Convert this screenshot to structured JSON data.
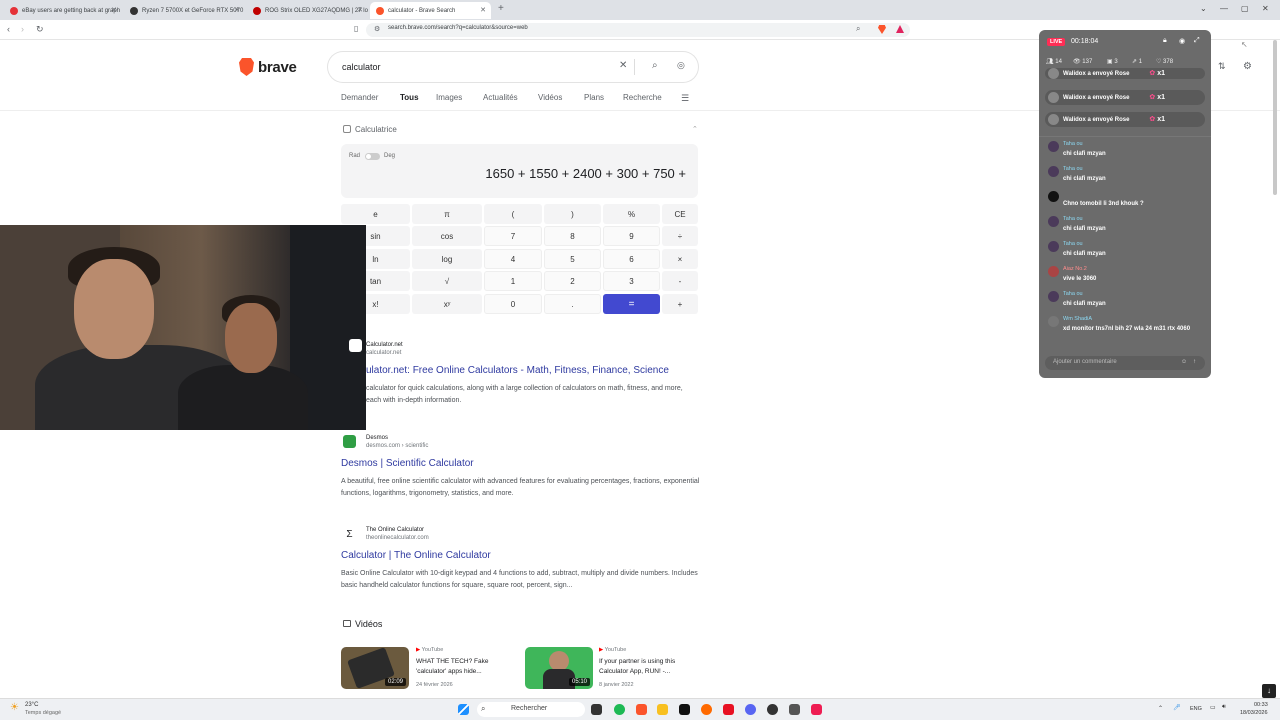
{
  "tabs": [
    {
      "title": "eBay users are getting back at graph",
      "color": "#e53238"
    },
    {
      "title": "Ryzen 7 5700X et GeForce RTX 5070",
      "color": "#333333"
    },
    {
      "title": "ROG Strix OLED XG27AQDMG | 27 lo",
      "color": "#c00000"
    },
    {
      "title": "calculator - Brave Search",
      "color": "#fb542b"
    }
  ],
  "new_tab": "+",
  "url": "search.brave.com/search?q=calculator&source=web",
  "brand": "brave",
  "search_query": "calculator",
  "nav_tabs": [
    "Demander",
    "Tous",
    "Images",
    "Actualités",
    "Vidéos",
    "Plans",
    "Recherche"
  ],
  "calc": {
    "title": "Calculatrice",
    "rad": "Rad",
    "deg": "Deg",
    "expression": "1650 + 1550 + 2400 + 300 + 750 +",
    "keys": [
      [
        "e",
        "π",
        "(",
        ")",
        "%",
        "CE"
      ],
      [
        "sin",
        "cos",
        "7",
        "8",
        "9",
        "÷"
      ],
      [
        "ln",
        "log",
        "4",
        "5",
        "6",
        "×"
      ],
      [
        "tan",
        "√",
        "1",
        "2",
        "3",
        "-"
      ],
      [
        "x!",
        "xʸ",
        "0",
        ".",
        "=",
        "+"
      ]
    ]
  },
  "results": [
    {
      "site": "Calculator.net",
      "url": "calculator.net",
      "title": "ulator.net: Free Online Calculators - Math, Fitness, Finance, Science",
      "desc": "calculator for quick calculations, along with a large collection of calculators on math, fitness, and more, each with in-depth information.",
      "color": "#ffffff"
    },
    {
      "site": "Desmos",
      "url": "desmos.com › scientific",
      "title": "Desmos | Scientific Calculator",
      "desc": "A beautiful, free online scientific calculator with advanced features for evaluating percentages, fractions, exponential functions, logarithms, trigonometry, statistics, and more.",
      "color": "#2f9e44"
    },
    {
      "site": "The Online Calculator",
      "url": "theonlinecalculator.com",
      "title": "Calculator | The Online Calculator",
      "desc": "Basic Online Calculator with 10-digit keypad and 4 functions to add, subtract, multiply and divide numbers. Includes basic handheld calculator functions for square, square root, percent, sign...",
      "color": "#ffffff"
    }
  ],
  "videos_header": "Vidéos",
  "videos": [
    {
      "source": "YouTube",
      "title": "WHAT THE TECH? Fake 'calculator' apps hide...",
      "date": "24 février 2026",
      "duration": "02:09",
      "color": "#6b5a3e"
    },
    {
      "source": "YouTube",
      "title": "If your partner is using this Calculator App, RUN! -...",
      "date": "8 janvier 2022",
      "duration": "05:10",
      "color": "#3fb65a"
    }
  ],
  "chat": {
    "live": "LIVE",
    "time": "00:18:04",
    "stats": [
      "14",
      "137",
      "3",
      "1",
      "378"
    ],
    "gifts": [
      "Walidox a envoyé Rose",
      "Walidox a envoyé Rose",
      "Walidox a envoyé Rose"
    ],
    "gift_count": "x1",
    "messages": [
      {
        "name": "Taha ou",
        "text": "chi clafi mzyan"
      },
      {
        "name": "Taha ou",
        "text": "chi clafi mzyan"
      },
      {
        "name": "",
        "text": "Chno tomobil li 3nd khouk ?"
      },
      {
        "name": "Taha ou",
        "text": "chi clafi mzyan"
      },
      {
        "name": "Taha ou",
        "text": "chi clafi mzyan"
      },
      {
        "name": "Aiaz  No.2",
        "text": "vive le 3060"
      },
      {
        "name": "Taha ou",
        "text": "chi clafi mzyan"
      },
      {
        "name": "Wm ShadiA",
        "text": "xd monitor tns7nl bih 27 wla 24 m31 rtx 4060"
      }
    ],
    "input_placeholder": "Ajouter un commentaire"
  },
  "taskbar": {
    "weather_temp": "23°C",
    "weather_desc": "Temps dégagé",
    "search": "Rechercher",
    "lang": "ENG",
    "time": "00:33",
    "date": "18/03/2026"
  }
}
